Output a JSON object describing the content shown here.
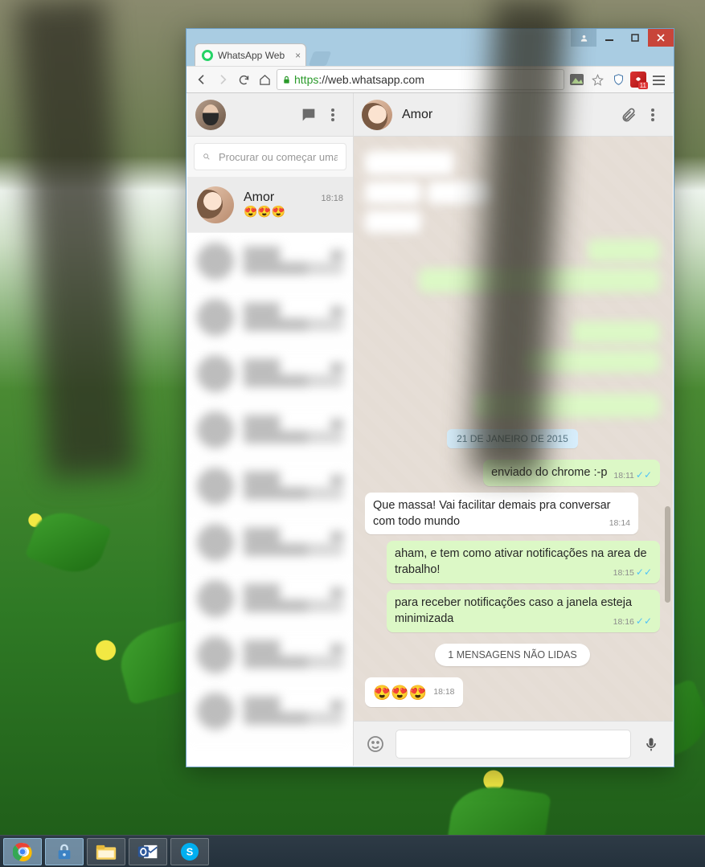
{
  "browser": {
    "tab_title": "WhatsApp Web",
    "url_scheme": "https",
    "url_host": "://web.whatsapp.com",
    "ext_badge": "11"
  },
  "window_controls": {
    "minimize": "—",
    "maximize": "☐",
    "close": "✕",
    "user": "👤"
  },
  "left_panel": {
    "search_placeholder": "Procurar ou começar uma nova conversa",
    "active_chat": {
      "name": "Amor",
      "time": "18:18",
      "preview": "😍😍😍"
    }
  },
  "right_panel": {
    "contact_name": "Amor",
    "date_separator": "21 DE JANEIRO DE 2015",
    "unread_separator": "1 MENSAGENS NÃO LIDAS",
    "messages": {
      "m1": {
        "text": "enviado do chrome :-p",
        "time": "18:11"
      },
      "m2": {
        "text": "Que massa! Vai facilitar demais pra conversar com todo mundo",
        "time": "18:14"
      },
      "m3": {
        "text": "aham, e tem como ativar notificações na area de trabalho!",
        "time": "18:15"
      },
      "m4": {
        "text": "para receber notificações caso a janela esteja minimizada",
        "time": "18:16"
      },
      "m5": {
        "text": "😍😍😍",
        "time": "18:18"
      }
    }
  },
  "taskbar": {
    "items": [
      "chrome",
      "lock",
      "explorer",
      "outlook",
      "skype"
    ]
  }
}
